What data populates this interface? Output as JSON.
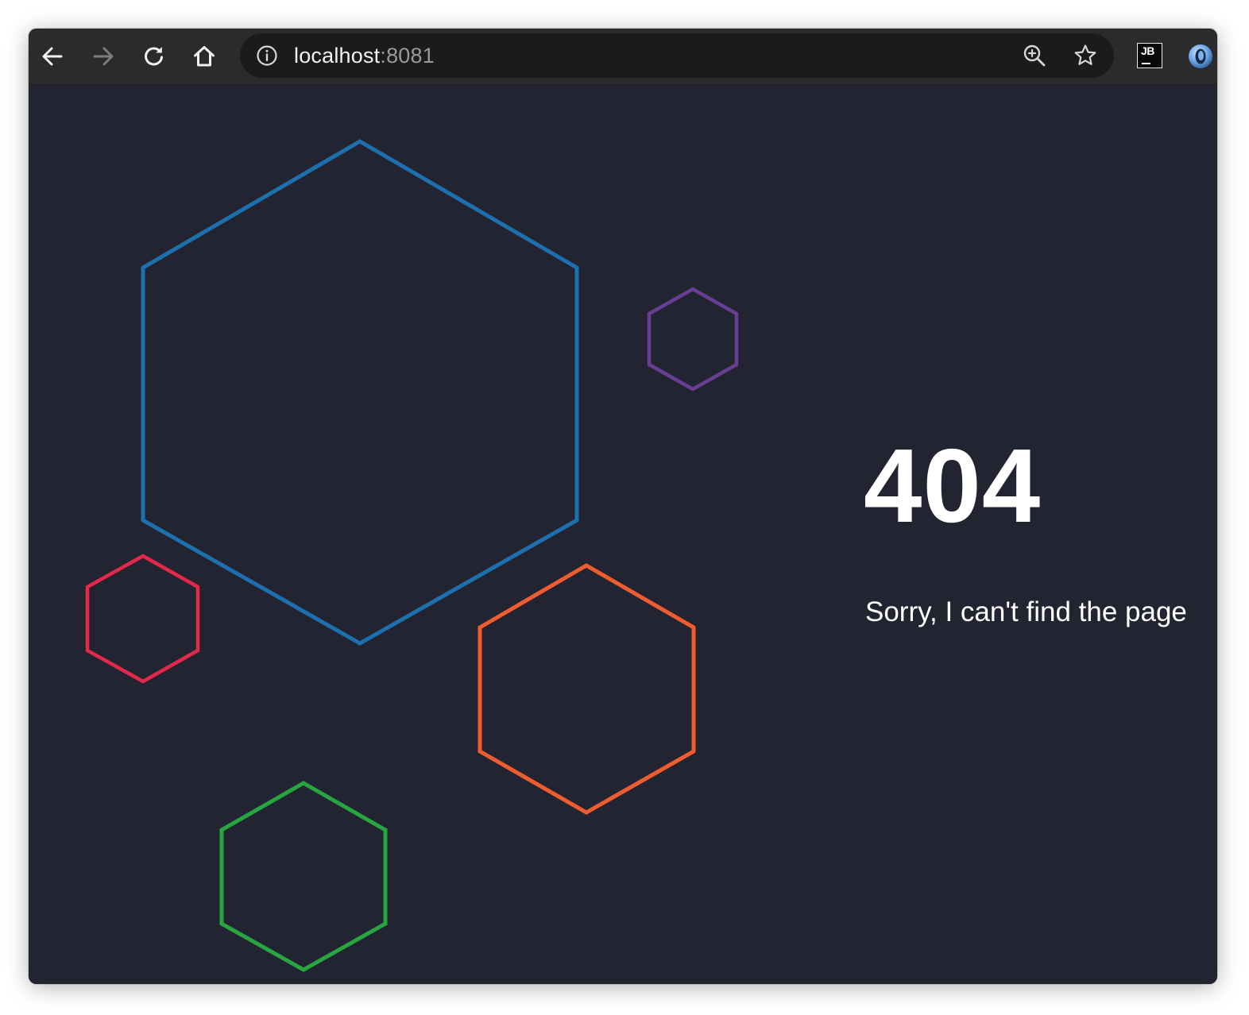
{
  "browser": {
    "url_host": "localhost",
    "url_port": ":8081",
    "icons": {
      "back": "back-arrow-icon",
      "forward": "forward-arrow-icon",
      "reload": "reload-icon",
      "home": "home-icon",
      "info": "info-icon",
      "zoom": "zoom-in-icon",
      "bookmark": "star-icon"
    },
    "extensions": {
      "jetbrains_label": "JB"
    }
  },
  "page": {
    "background": "#222431",
    "error_code": "404",
    "message": "Sorry, I can't find the page",
    "hexagon_colors": {
      "large": "#1d6fad",
      "purple": "#683e94",
      "red": "#e3284a",
      "orange": "#ee5c30",
      "green": "#26a541"
    }
  }
}
